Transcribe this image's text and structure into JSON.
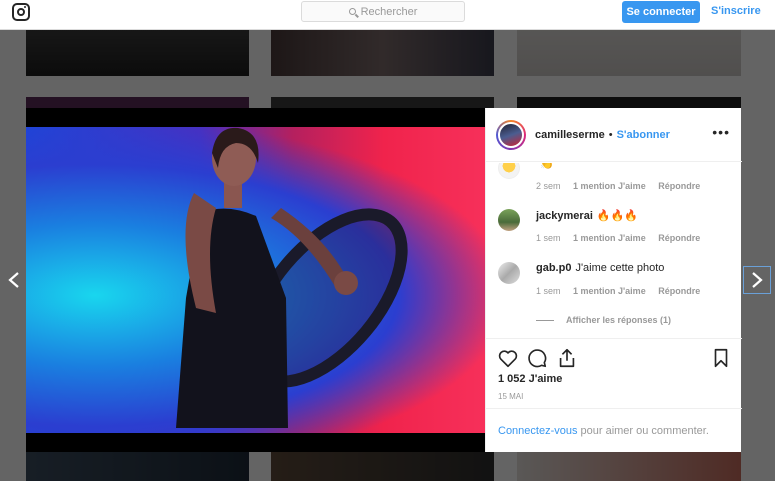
{
  "topbar": {
    "search_placeholder": "Rechercher",
    "login_label": "Se connecter",
    "signup_label": "S'inscrire"
  },
  "post": {
    "username": "camilleserme",
    "separator": "•",
    "follow_label": "S'abonner",
    "more_label": "•••",
    "comments": [
      {
        "user": "",
        "text": "👏",
        "time": "2 sem",
        "likes": "1 mention J'aime",
        "reply": "Répondre"
      },
      {
        "user": "jackymerai",
        "text": "🔥🔥🔥",
        "time": "1 sem",
        "likes": "1 mention J'aime",
        "reply": "Répondre"
      },
      {
        "user": "gab.p0",
        "text": "J'aime cette photo",
        "time": "1 sem",
        "likes": "1 mention J'aime",
        "reply": "Répondre"
      }
    ],
    "show_replies": "Afficher les réponses (1)",
    "likes_count": "1 052 J'aime",
    "date": "15 MAI",
    "login_link": "Connectez-vous",
    "login_suffix": "pour aimer ou commenter."
  },
  "colors": {
    "accent": "#3897f0",
    "text": "#262626",
    "muted": "#999999",
    "border": "#efefef"
  },
  "icons": {
    "heart": "heart-icon",
    "comment": "comment-icon",
    "share": "share-icon",
    "bookmark": "bookmark-icon"
  }
}
